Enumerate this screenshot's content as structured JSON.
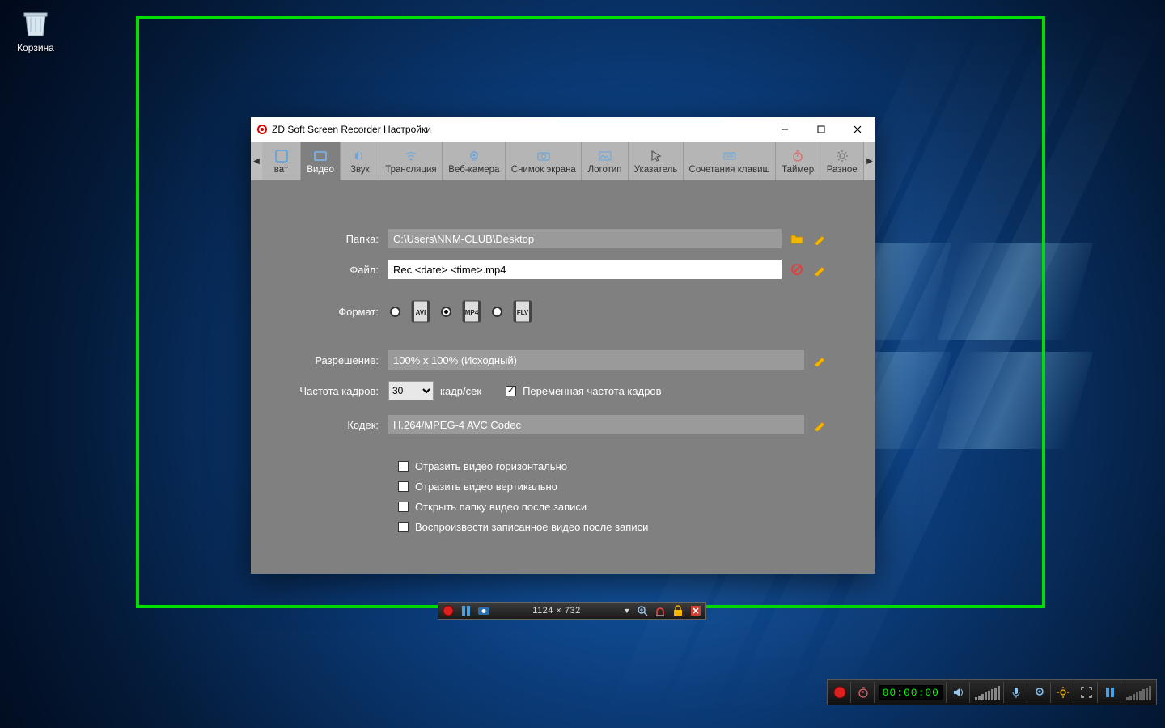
{
  "desktop": {
    "recycle_bin_label": "Корзина"
  },
  "window": {
    "title": "ZD Soft Screen Recorder Настройки",
    "tabs": {
      "capture": "ват",
      "video": "Видео",
      "audio": "Звук",
      "streaming": "Трансляция",
      "webcam": "Веб-камера",
      "screenshot": "Снимок экрана",
      "logo": "Логотип",
      "pointer": "Указатель",
      "shortcuts": "Сочетания клавиш",
      "timer": "Таймер",
      "misc": "Разное"
    },
    "labels": {
      "folder": "Папка:",
      "file": "Файл:",
      "format": "Формат:",
      "resolution": "Разрешение:",
      "framerate": "Частота кадров:",
      "codec": "Кодек:"
    },
    "values": {
      "folder": "C:\\Users\\NNM-CLUB\\Desktop",
      "file": "Rec <date> <time>.mp4",
      "resolution": "100% x 100% (Исходный)",
      "framerate": "30",
      "framerate_unit": "кадр/сек",
      "variable_fps_label": "Переменная частота кадров",
      "codec": "H.264/MPEG-4 AVC Codec"
    },
    "formats": {
      "avi": "AVI",
      "mp4": "MP4",
      "flv": "FLV"
    },
    "checkboxes": {
      "flip_h": "Отразить видео горизонтально",
      "flip_v": "Отразить видео вертикально",
      "open_folder": "Открыть папку видео после записи",
      "play_after": "Воспроизвести записанное видео после записи"
    }
  },
  "controlbar": {
    "size_readout": "1124 × 732"
  },
  "tray": {
    "timecode": "00:00:00"
  }
}
